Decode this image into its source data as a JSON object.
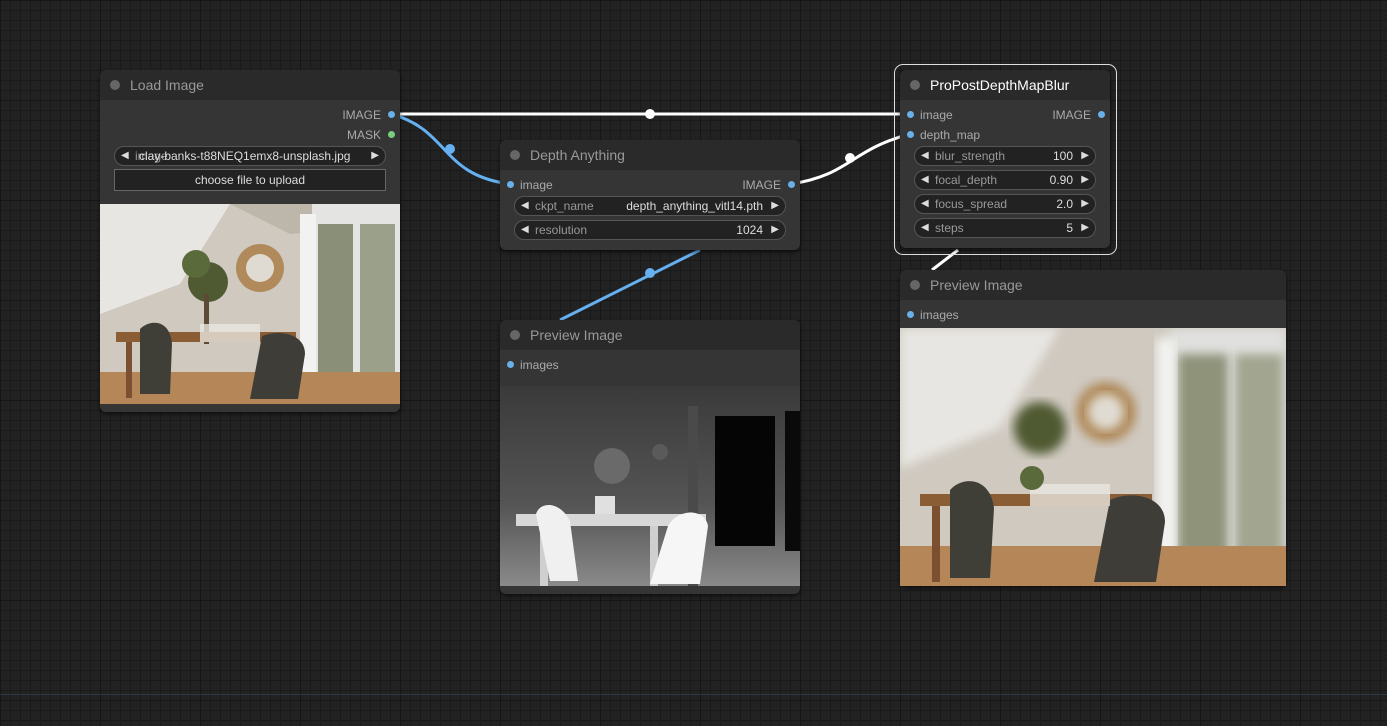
{
  "nodes": {
    "load_image": {
      "title": "Load Image",
      "outputs": [
        "IMAGE",
        "MASK"
      ],
      "image_widget": {
        "value": "clay-banks-t88NEQ1emx8-unsplash.jpg",
        "overlap_label": "image"
      },
      "upload_label": "choose file to upload"
    },
    "depth_anything": {
      "title": "Depth Anything",
      "input": "image",
      "output": "IMAGE",
      "widgets": [
        {
          "label": "ckpt_name",
          "value": "depth_anything_vitl14.pth"
        },
        {
          "label": "resolution",
          "value": "1024"
        }
      ]
    },
    "pro_post": {
      "title": "ProPostDepthMapBlur",
      "inputs": [
        "image",
        "depth_map"
      ],
      "output": "IMAGE",
      "widgets": [
        {
          "label": "blur_strength",
          "value": "100"
        },
        {
          "label": "focal_depth",
          "value": "0.90"
        },
        {
          "label": "focus_spread",
          "value": "2.0"
        },
        {
          "label": "steps",
          "value": "5"
        }
      ]
    },
    "preview_depth": {
      "title": "Preview Image",
      "input": "images"
    },
    "preview_blur": {
      "title": "Preview Image",
      "input": "images"
    }
  },
  "colors": {
    "image_link": "#64b0f0",
    "white_link": "#ffffff",
    "mask_slot": "#7ad07a"
  }
}
